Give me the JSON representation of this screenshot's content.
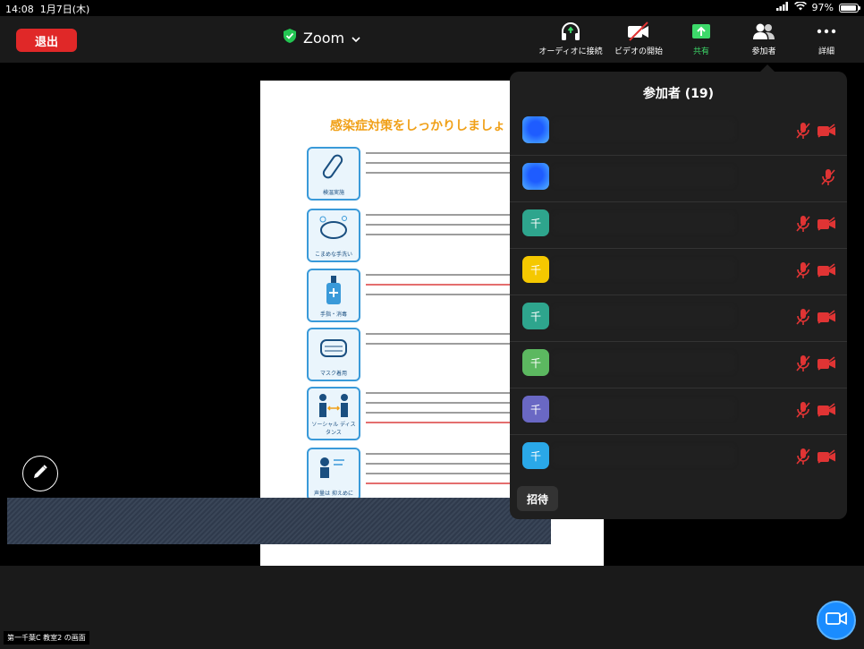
{
  "status_bar": {
    "time": "14:08",
    "date": "1月7日(木)",
    "battery": "97%",
    "battery_level": 0.97
  },
  "header": {
    "leave_label": "退出",
    "meeting_title": "Zoom",
    "toolbar": [
      {
        "label": "オーディオに接続",
        "icon": "headphones-icon"
      },
      {
        "label": "ビデオの開始",
        "icon": "video-off-icon"
      },
      {
        "label": "共有",
        "icon": "share-screen-icon"
      },
      {
        "label": "参加者",
        "icon": "participants-icon"
      },
      {
        "label": "詳細",
        "icon": "more-icon"
      }
    ]
  },
  "shared_document": {
    "title": "感染症対策をしっかりしましょ",
    "icon_captions": [
      "検温実施",
      "こまめな手洗い",
      "手指・消毒",
      "マスク着用",
      "ソーシャル ディスタンス",
      "声量は 抑えめに"
    ]
  },
  "participants_panel": {
    "title": "参加者 (19)",
    "participants": [
      {
        "avatar_initial": "",
        "avatar_color": "#2a6cff",
        "name": "",
        "muted": true,
        "video_off": true
      },
      {
        "avatar_initial": "",
        "avatar_color": "#2a6cff",
        "name": "",
        "muted": true,
        "video_off": false
      },
      {
        "avatar_initial": "千",
        "avatar_color": "#2ea58d",
        "name": "",
        "muted": true,
        "video_off": true
      },
      {
        "avatar_initial": "千",
        "avatar_color": "#f5c800",
        "name": "",
        "muted": true,
        "video_off": true
      },
      {
        "avatar_initial": "千",
        "avatar_color": "#2ea58d",
        "name": "",
        "muted": true,
        "video_off": true
      },
      {
        "avatar_initial": "千",
        "avatar_color": "#5cb860",
        "name": "",
        "muted": true,
        "video_off": true
      },
      {
        "avatar_initial": "千",
        "avatar_color": "#6a68c4",
        "name": "",
        "muted": true,
        "video_off": true
      },
      {
        "avatar_initial": "千",
        "avatar_color": "#2aa8e8",
        "name": "",
        "muted": true,
        "video_off": true
      }
    ],
    "invite_label": "招待"
  },
  "footer": {
    "viewing_label": "第一千葉C 教室2 の画面"
  },
  "colors": {
    "accent_red": "#e02828",
    "share_green": "#3dd96a",
    "camera_blue": "#1a8cff",
    "mic_red": "#e03434"
  }
}
